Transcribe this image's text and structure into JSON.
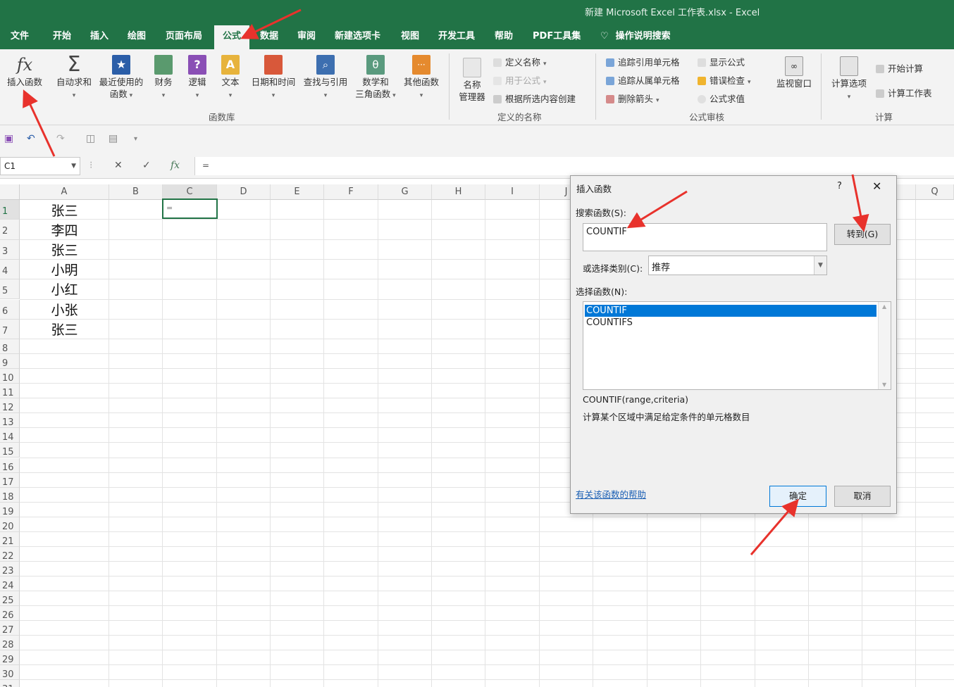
{
  "window": {
    "title": "新建 Microsoft Excel 工作表.xlsx  -  Excel"
  },
  "menu_tabs": [
    "文件",
    "开始",
    "插入",
    "绘图",
    "页面布局",
    "公式",
    "数据",
    "审阅",
    "新建选项卡",
    "视图",
    "开发工具",
    "帮助",
    "PDF工具集",
    "操作说明搜索"
  ],
  "active_tab": "公式",
  "ribbon": {
    "function_library": {
      "insert_function": "插入函数",
      "autosum": "自动求和",
      "recent_line1": "最近使用的",
      "recent_line2": "函数",
      "financial": "财务",
      "logical": "逻辑",
      "text": "文本",
      "datetime": "日期和时间",
      "lookup": "查找与引用",
      "math_line1": "数学和",
      "math_line2": "三角函数",
      "more": "其他函数",
      "group": "函数库"
    },
    "defined_names": {
      "name_manager_line1": "名称",
      "name_manager_line2": "管理器",
      "define_name": "定义名称",
      "use_in_formula": "用于公式",
      "create_from_selection": "根据所选内容创建",
      "group": "定义的名称"
    },
    "formula_auditing": {
      "trace_precedents": "追踪引用单元格",
      "trace_dependents": "追踪从属单元格",
      "remove_arrows": "删除箭头",
      "show_formulas": "显示公式",
      "error_checking": "错误检查",
      "evaluate": "公式求值",
      "watch_window": "监视窗口",
      "group": "公式审核"
    },
    "calculation": {
      "options": "计算选项",
      "calc_now": "开始计算",
      "calc_sheet": "计算工作表",
      "group": "计算"
    }
  },
  "formula_bar": {
    "name_box": "C1",
    "content": "="
  },
  "sheet": {
    "columns": [
      "A",
      "B",
      "C",
      "D",
      "E",
      "F",
      "G",
      "H",
      "I",
      "J",
      "Q"
    ],
    "rows": [
      "1",
      "2",
      "3",
      "4",
      "5",
      "6",
      "7",
      "8",
      "9",
      "10",
      "11",
      "12",
      "13",
      "14",
      "15",
      "16",
      "17",
      "18",
      "19",
      "20",
      "21",
      "22",
      "23",
      "24",
      "25",
      "26",
      "27",
      "28",
      "29",
      "30",
      "31"
    ],
    "col_a_values": [
      "张三",
      "李四",
      "张三",
      "小明",
      "小红",
      "小张",
      "张三"
    ],
    "c1_value": "="
  },
  "dialog": {
    "title": "插入函数",
    "help": "?",
    "close": "✕",
    "search_label": "搜索函数(S):",
    "search_value": "COUNTIF",
    "goto_button": "转到(G)",
    "category_label": "或选择类别(C):",
    "category_value": "推荐",
    "select_label": "选择函数(N):",
    "functions": [
      "COUNTIF",
      "COUNTIFS"
    ],
    "signature": "COUNTIF(range,criteria)",
    "description": "计算某个区域中满足给定条件的单元格数目",
    "help_link": "有关该函数的帮助",
    "ok_button": "确定",
    "cancel_button": "取消"
  },
  "colors": {
    "excel_green": "#217346",
    "selection_blue": "#0078d7",
    "arrow_red": "#e8322c"
  }
}
